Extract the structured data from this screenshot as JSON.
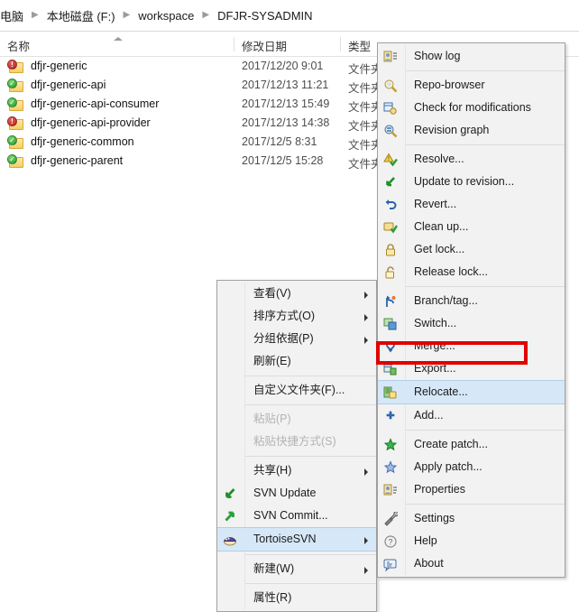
{
  "window": {
    "breadcrumb": {
      "items": [
        "电脑",
        "本地磁盘 (F:)",
        "workspace",
        "DFJR-SYSADMIN"
      ],
      "separator": "▶"
    },
    "columns": {
      "name": "名称",
      "date_modified": "修改日期",
      "type": "类型",
      "sort_indicator": "ascending"
    },
    "files": [
      {
        "name": "dfjr-generic",
        "date": "2017/12/20 9:01",
        "type": "文件夹",
        "status": "modified"
      },
      {
        "name": "dfjr-generic-api",
        "date": "2017/12/13 11:21",
        "type": "文件夹",
        "status": "normal"
      },
      {
        "name": "dfjr-generic-api-consumer",
        "date": "2017/12/13 15:49",
        "type": "文件夹",
        "status": "normal"
      },
      {
        "name": "dfjr-generic-api-provider",
        "date": "2017/12/13 14:38",
        "type": "文件夹",
        "status": "modified"
      },
      {
        "name": "dfjr-generic-common",
        "date": "2017/12/5 8:31",
        "type": "文件夹",
        "status": "normal"
      },
      {
        "name": "dfjr-generic-parent",
        "date": "2017/12/5 15:28",
        "type": "文件夹",
        "status": "normal"
      }
    ]
  },
  "context_menu": {
    "items": [
      {
        "label": "查看(V)",
        "icon": "none",
        "submenu": true,
        "disabled": false,
        "highlighted": false,
        "separator_after": false
      },
      {
        "label": "排序方式(O)",
        "icon": "none",
        "submenu": true,
        "disabled": false,
        "highlighted": false,
        "separator_after": false
      },
      {
        "label": "分组依据(P)",
        "icon": "none",
        "submenu": true,
        "disabled": false,
        "highlighted": false,
        "separator_after": false
      },
      {
        "label": "刷新(E)",
        "icon": "none",
        "submenu": false,
        "disabled": false,
        "highlighted": false,
        "separator_after": true
      },
      {
        "label": "自定义文件夹(F)...",
        "icon": "none",
        "submenu": false,
        "disabled": false,
        "highlighted": false,
        "separator_after": true
      },
      {
        "label": "粘贴(P)",
        "icon": "none",
        "submenu": false,
        "disabled": true,
        "highlighted": false,
        "separator_after": false
      },
      {
        "label": "粘贴快捷方式(S)",
        "icon": "none",
        "submenu": false,
        "disabled": true,
        "highlighted": false,
        "separator_after": true
      },
      {
        "label": "共享(H)",
        "icon": "none",
        "submenu": true,
        "disabled": false,
        "highlighted": false,
        "separator_after": false
      },
      {
        "label": "SVN Update",
        "icon": "svn-update-icon",
        "submenu": false,
        "disabled": false,
        "highlighted": false,
        "separator_after": false
      },
      {
        "label": "SVN Commit...",
        "icon": "svn-commit-icon",
        "submenu": false,
        "disabled": false,
        "highlighted": false,
        "separator_after": false
      },
      {
        "label": "TortoiseSVN",
        "icon": "tortoise-icon",
        "submenu": true,
        "disabled": false,
        "highlighted": true,
        "separator_after": true
      },
      {
        "label": "新建(W)",
        "icon": "none",
        "submenu": true,
        "disabled": false,
        "highlighted": false,
        "separator_after": true
      },
      {
        "label": "属性(R)",
        "icon": "none",
        "submenu": false,
        "disabled": false,
        "highlighted": false,
        "separator_after": false
      }
    ]
  },
  "tortoise_submenu": {
    "items": [
      {
        "label": "Show log",
        "icon": "show-log-icon",
        "highlighted": false,
        "annotated": false,
        "separator_after": true
      },
      {
        "label": "Repo-browser",
        "icon": "repo-browser-icon",
        "highlighted": false,
        "annotated": false,
        "separator_after": false
      },
      {
        "label": "Check for modifications",
        "icon": "check-mods-icon",
        "highlighted": false,
        "annotated": false,
        "separator_after": false
      },
      {
        "label": "Revision graph",
        "icon": "revision-graph-icon",
        "highlighted": false,
        "annotated": false,
        "separator_after": true
      },
      {
        "label": "Resolve...",
        "icon": "resolve-icon",
        "highlighted": false,
        "annotated": false,
        "separator_after": false
      },
      {
        "label": "Update to revision...",
        "icon": "update-revision-icon",
        "highlighted": false,
        "annotated": false,
        "separator_after": false
      },
      {
        "label": "Revert...",
        "icon": "revert-icon",
        "highlighted": false,
        "annotated": false,
        "separator_after": false
      },
      {
        "label": "Clean up...",
        "icon": "cleanup-icon",
        "highlighted": false,
        "annotated": false,
        "separator_after": false
      },
      {
        "label": "Get lock...",
        "icon": "lock-closed-icon",
        "highlighted": false,
        "annotated": false,
        "separator_after": false
      },
      {
        "label": "Release lock...",
        "icon": "lock-open-icon",
        "highlighted": false,
        "annotated": false,
        "separator_after": true
      },
      {
        "label": "Branch/tag...",
        "icon": "branch-tag-icon",
        "highlighted": false,
        "annotated": false,
        "separator_after": false
      },
      {
        "label": "Switch...",
        "icon": "switch-icon",
        "highlighted": false,
        "annotated": false,
        "separator_after": false
      },
      {
        "label": "Merge...",
        "icon": "merge-icon",
        "highlighted": false,
        "annotated": false,
        "separator_after": false
      },
      {
        "label": "Export...",
        "icon": "export-icon",
        "highlighted": false,
        "annotated": false,
        "separator_after": false
      },
      {
        "label": "Relocate...",
        "icon": "relocate-icon",
        "highlighted": true,
        "annotated": true,
        "separator_after": false
      },
      {
        "label": "Add...",
        "icon": "add-icon",
        "highlighted": false,
        "annotated": false,
        "separator_after": true
      },
      {
        "label": "Create patch...",
        "icon": "create-patch-icon",
        "highlighted": false,
        "annotated": false,
        "separator_after": false
      },
      {
        "label": "Apply patch...",
        "icon": "apply-patch-icon",
        "highlighted": false,
        "annotated": false,
        "separator_after": false
      },
      {
        "label": "Properties",
        "icon": "properties-icon",
        "highlighted": false,
        "annotated": false,
        "separator_after": true
      },
      {
        "label": "Settings",
        "icon": "settings-icon",
        "highlighted": false,
        "annotated": false,
        "separator_after": false
      },
      {
        "label": "Help",
        "icon": "help-icon",
        "highlighted": false,
        "annotated": false,
        "separator_after": false
      },
      {
        "label": "About",
        "icon": "about-icon",
        "highlighted": false,
        "annotated": false,
        "separator_after": false
      }
    ]
  },
  "annotation": {
    "target_label": "Relocate...",
    "color": "#e00000"
  },
  "colors": {
    "highlight_bg": "#d6e8f7",
    "highlight_border": "#b0cfe8",
    "menu_bg": "#f2f2f2",
    "annotation_red": "#e00000",
    "status_modified": "#b5211c",
    "status_normal": "#1f9b2d"
  }
}
